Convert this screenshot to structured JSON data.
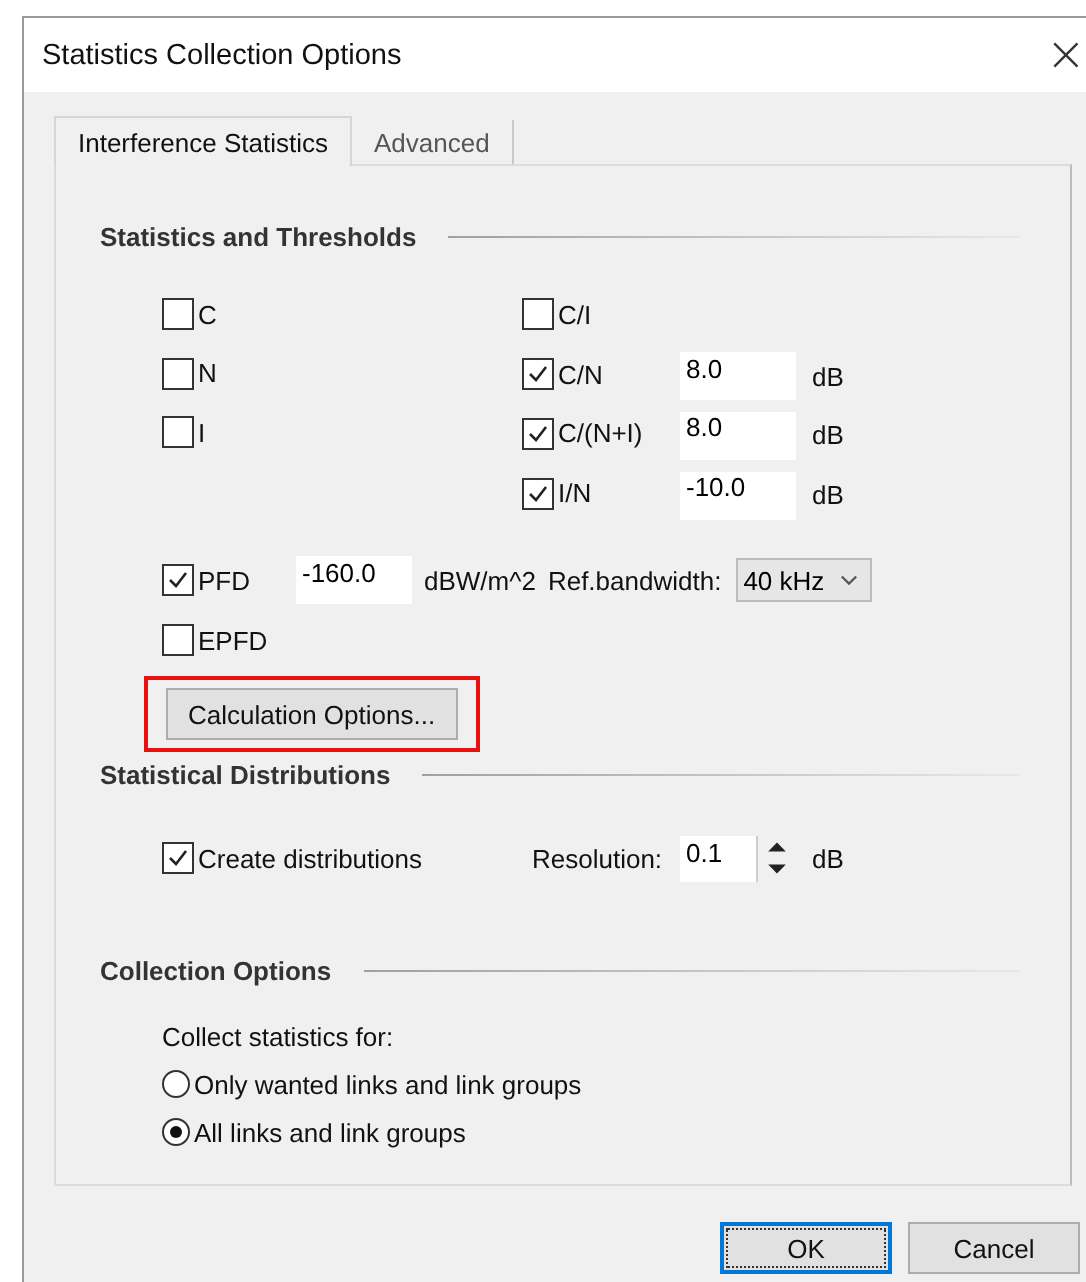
{
  "window": {
    "title": "Statistics Collection Options",
    "close": "×"
  },
  "tabs": [
    {
      "label": "Interference Statistics",
      "selected": true
    },
    {
      "label": "Advanced",
      "selected": false
    }
  ],
  "thresholds": {
    "title": "Statistics and Thresholds",
    "rows": [
      {
        "left": {
          "label": "C",
          "checked": false
        },
        "right": {
          "label": "C/I",
          "checked": false
        }
      },
      {
        "left": {
          "label": "N",
          "checked": false
        },
        "right": {
          "label": "C/N",
          "checked": true,
          "value": "8.0",
          "unit": "dB"
        }
      },
      {
        "left": {
          "label": "I",
          "checked": false
        },
        "right": {
          "label": "C/(N+I)",
          "checked": true,
          "value": "8.0",
          "unit": "dB"
        }
      },
      {
        "right": {
          "label": "I/N",
          "checked": true,
          "value": "-10.0",
          "unit": "dB"
        }
      }
    ],
    "pfd": {
      "label": "PFD",
      "checked": true,
      "value": "-160.0",
      "unit": "dBW/m^2",
      "bandwidth_label": "Ref.bandwidth:",
      "bandwidth": "40 kHz"
    },
    "epfd": {
      "label": "EPFD",
      "checked": false
    },
    "calc_button": {
      "label": "Calculation Options...",
      "highlighted": true
    }
  },
  "distributions": {
    "title": "Statistical Distributions",
    "create": {
      "label": "Create distributions",
      "checked": true
    },
    "resolution": {
      "label": "Resolution:",
      "value": "0.1",
      "unit": "dB"
    }
  },
  "collection": {
    "title": "Collection Options",
    "prompt": "Collect statistics for:",
    "options": [
      {
        "label": "Only wanted links and link groups",
        "selected": false
      },
      {
        "label": "All links and link groups",
        "selected": true
      }
    ]
  },
  "buttons": [
    {
      "label": "OK",
      "default": true
    },
    {
      "label": "Cancel",
      "default": false
    }
  ]
}
